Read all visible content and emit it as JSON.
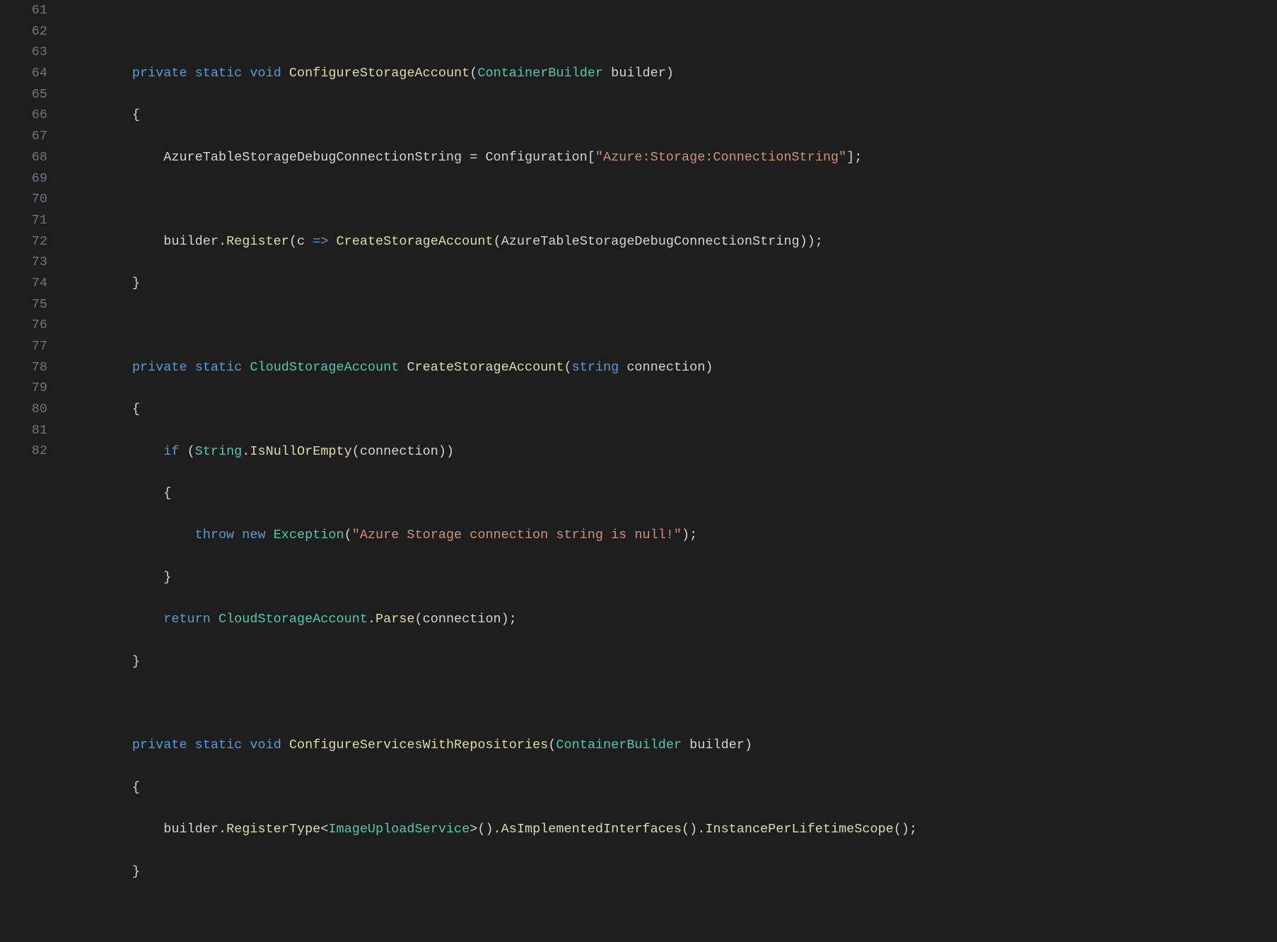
{
  "gutter": {
    "start": 61,
    "end": 82
  },
  "code": {
    "l61": "",
    "l62_kw1": "private",
    "l62_kw2": "static",
    "l62_kw3": "void",
    "l62_fn": "ConfigureStorageAccount",
    "l62_type": "ContainerBuilder",
    "l62_param": "builder",
    "l63": "        {",
    "l64_ident": "AzureTableStorageDebugConnectionString",
    "l64_ident2": "Configuration",
    "l64_str": "\"Azure:Storage:ConnectionString\"",
    "l65": "",
    "l66_ident": "builder",
    "l66_fn": "Register",
    "l66_p": "c",
    "l66_arrow": "=>",
    "l66_fn2": "CreateStorageAccount",
    "l66_arg": "AzureTableStorageDebugConnectionString",
    "l67": "        }",
    "l68": "",
    "l69_kw1": "private",
    "l69_kw2": "static",
    "l69_type": "CloudStorageAccount",
    "l69_fn": "CreateStorageAccount",
    "l69_ptype": "string",
    "l69_param": "connection",
    "l70": "        {",
    "l71_kw": "if",
    "l71_type": "String",
    "l71_fn": "IsNullOrEmpty",
    "l71_arg": "connection",
    "l72": "            {",
    "l73_kw1": "throw",
    "l73_kw2": "new",
    "l73_type": "Exception",
    "l73_str": "\"Azure Storage connection string is null!\"",
    "l74": "            }",
    "l75_kw": "return",
    "l75_type": "CloudStorageAccount",
    "l75_fn": "Parse",
    "l75_arg": "connection",
    "l76": "        }",
    "l77": "",
    "l78_kw1": "private",
    "l78_kw2": "static",
    "l78_kw3": "void",
    "l78_fn": "ConfigureServicesWithRepositories",
    "l78_type": "ContainerBuilder",
    "l78_param": "builder",
    "l79": "        {",
    "l80_ident": "builder",
    "l80_fn": "RegisterType",
    "l80_type": "ImageUploadService",
    "l80_fn2": "AsImplementedInterfaces",
    "l80_fn3": "InstancePerLifetimeScope",
    "l81": "        }",
    "l82": ""
  }
}
